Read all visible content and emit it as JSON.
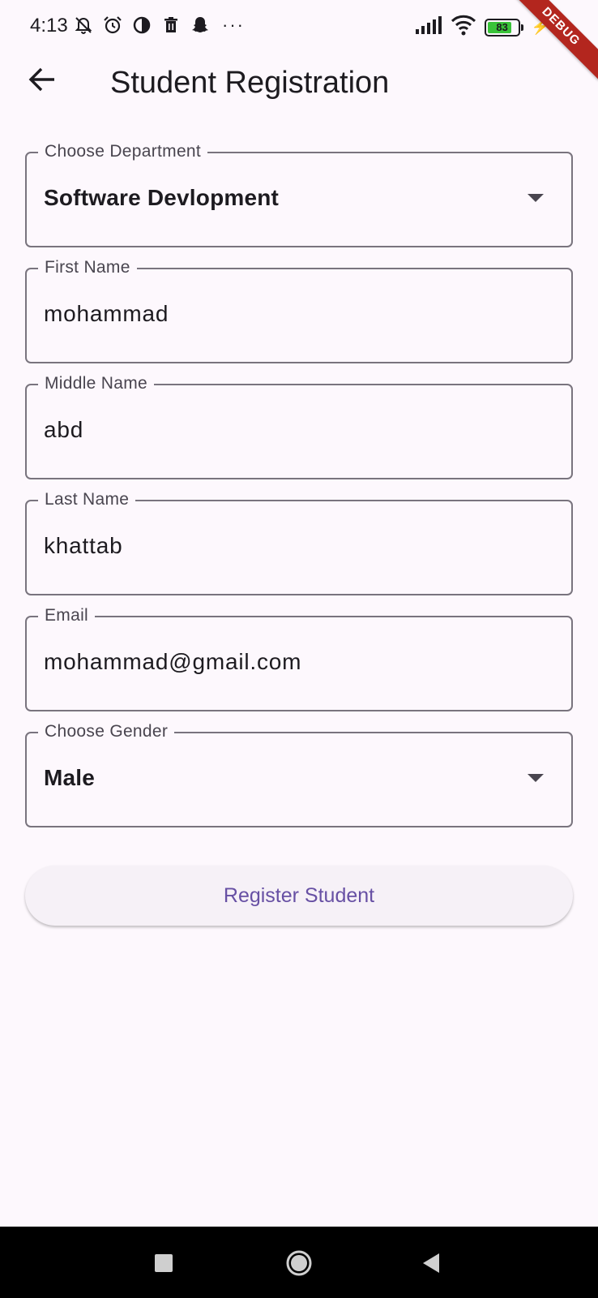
{
  "status_bar": {
    "time": "4:13",
    "dots": "···",
    "battery_level": "83",
    "battery_fraction": 0.83,
    "icons": [
      "mute-vibrate-icon",
      "alarm-icon",
      "data-saver-icon",
      "trash-icon",
      "snapchat-icon",
      "signal-icon",
      "wifi-icon",
      "battery-icon",
      "charging-icon"
    ]
  },
  "debug_banner": "DEBUG",
  "app_bar": {
    "title": "Student Registration",
    "back_icon": "arrow-back-icon"
  },
  "form": {
    "department": {
      "label": "Choose Department",
      "value": "Software Devlopment"
    },
    "first_name": {
      "label": "First Name",
      "value": "mohammad"
    },
    "middle_name": {
      "label": "Middle Name",
      "value": "abd"
    },
    "last_name": {
      "label": "Last Name",
      "value": "khattab"
    },
    "email": {
      "label": "Email",
      "value": "mohammad@gmail.com"
    },
    "gender": {
      "label": "Choose Gender",
      "value": "Male"
    },
    "submit_label": "Register Student"
  },
  "colors": {
    "background": "#fdf8fd",
    "accent": "#6750a4",
    "outline": "#79747e",
    "debug_banner": "#b3261e",
    "battery": "#39c339"
  },
  "nav_bar": {
    "buttons": [
      "recents-button",
      "home-button",
      "back-button"
    ]
  }
}
